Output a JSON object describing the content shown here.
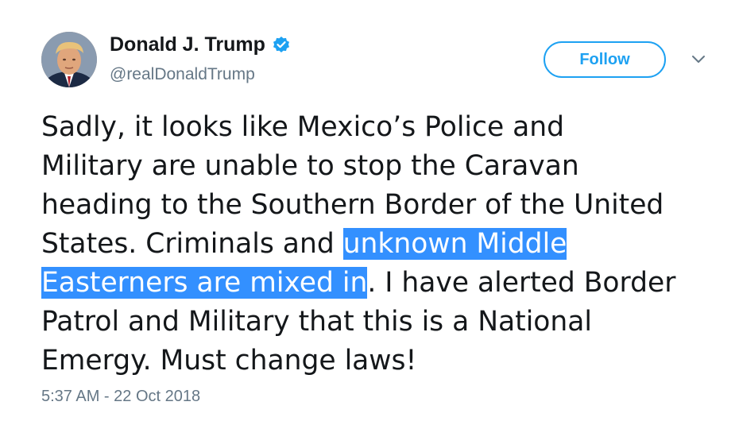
{
  "author": {
    "display_name": "Donald J. Trump",
    "handle": "@realDonaldTrump",
    "verified": true,
    "avatar_icon": "profile-photo"
  },
  "actions": {
    "follow_label": "Follow",
    "menu_icon": "chevron-down-icon"
  },
  "tweet": {
    "lines": [
      {
        "before": "Sadly, it looks like Mexico’s Police and",
        "highlight": "",
        "after": ""
      },
      {
        "before": "Military are unable to stop the Caravan",
        "highlight": "",
        "after": ""
      },
      {
        "before": "heading to the Southern Border of the United",
        "highlight": "",
        "after": ""
      },
      {
        "before": "States. Criminals and ",
        "highlight": "unknown Middle ",
        "after": ""
      },
      {
        "before": "",
        "highlight": "Easterners are mixed in",
        "after": ". I have alerted Border"
      },
      {
        "before": "Patrol and Military that this is a National",
        "highlight": "",
        "after": ""
      },
      {
        "before": "Emergy. Must change laws!",
        "highlight": "",
        "after": ""
      }
    ],
    "timestamp": "5:37 AM - 22 Oct 2018"
  },
  "colors": {
    "accent": "#1da1f2",
    "text": "#14171a",
    "secondary_text": "#657786",
    "selection_highlight": "#3390ff"
  }
}
